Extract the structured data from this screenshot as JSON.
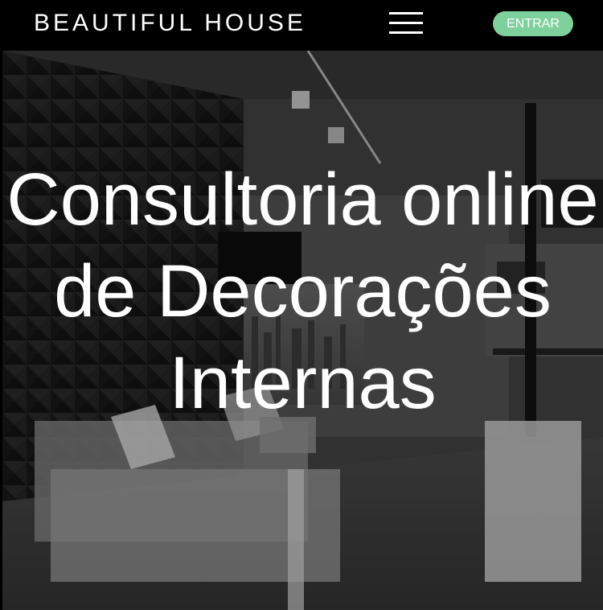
{
  "header": {
    "brand": "BEAUTIFUL HOUSE",
    "menu_icon": "hamburger-menu-icon",
    "login_label": "ENTRAR"
  },
  "hero": {
    "title": "Consultoria online de Decorações Internas"
  },
  "colors": {
    "header_background": "#000000",
    "accent": "#7ed09c",
    "title_text": "#ffffff"
  }
}
